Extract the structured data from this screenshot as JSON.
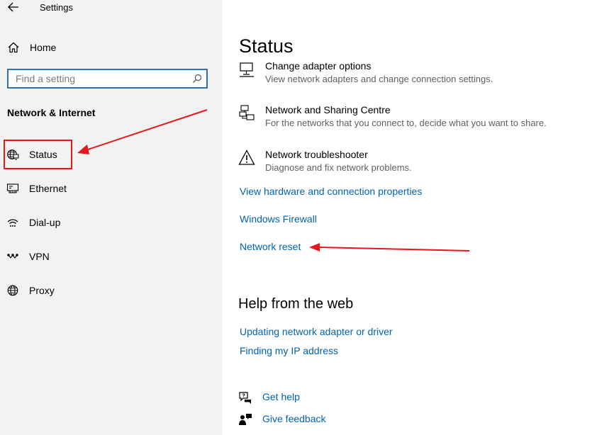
{
  "window": {
    "title": "Settings"
  },
  "sidebar": {
    "home_label": "Home",
    "search_placeholder": "Find a setting",
    "section_title": "Network & Internet",
    "items": [
      {
        "label": "Status",
        "icon": "globe-monitor-icon",
        "selected": true
      },
      {
        "label": "Ethernet",
        "icon": "ethernet-icon"
      },
      {
        "label": "Dial-up",
        "icon": "dialup-icon"
      },
      {
        "label": "VPN",
        "icon": "vpn-icon"
      },
      {
        "label": "Proxy",
        "icon": "globe-icon"
      }
    ]
  },
  "main": {
    "title": "Status",
    "options": [
      {
        "title": "Change adapter options",
        "desc": "View network adapters and change connection settings.",
        "icon": "monitor-icon"
      },
      {
        "title": "Network and Sharing Centre",
        "desc": "For the networks that you connect to, decide what you want to share.",
        "icon": "sharing-icon"
      },
      {
        "title": "Network troubleshooter",
        "desc": "Diagnose and fix network problems.",
        "icon": "warning-icon"
      }
    ],
    "links": [
      "View hardware and connection properties",
      "Windows Firewall",
      "Network reset"
    ],
    "help_title": "Help from the web",
    "help_links": [
      "Updating network adapter or driver",
      "Finding my IP address"
    ],
    "footer": [
      {
        "label": "Get help",
        "icon": "chat-help-icon"
      },
      {
        "label": "Give feedback",
        "icon": "feedback-icon"
      }
    ]
  },
  "colors": {
    "link": "#0063b1",
    "annotation": "#e8151b",
    "search_border": "#2f6fb3",
    "sidebar_bg": "#f2f2f2"
  }
}
